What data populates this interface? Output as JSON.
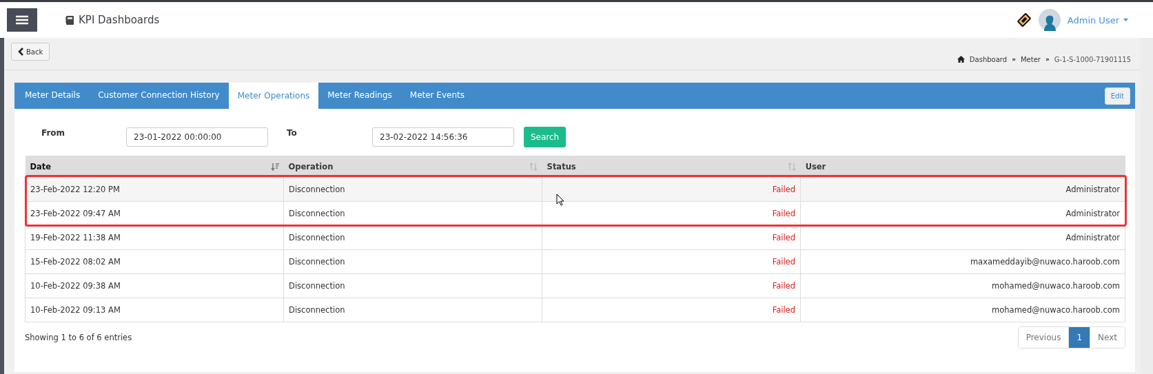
{
  "header": {
    "title": "KPI Dashboards",
    "user": "Admin User"
  },
  "back_button": "Back",
  "breadcrumb": [
    {
      "text": "Dashboard",
      "kind": "link"
    },
    {
      "text": "»",
      "kind": "separator"
    },
    {
      "text": "Meter",
      "kind": "link"
    },
    {
      "text": "»",
      "kind": "separator"
    },
    {
      "text": "G-1-S-1000-71901115",
      "kind": "current"
    }
  ],
  "tabs": [
    {
      "label": "Meter Details",
      "selected": false
    },
    {
      "label": "Customer Connection History",
      "selected": false
    },
    {
      "label": "Meter Operations",
      "selected": true
    },
    {
      "label": "Meter Readings",
      "selected": false
    },
    {
      "label": "Meter Events",
      "selected": false
    }
  ],
  "edit_button": "Edit",
  "filter": {
    "from_label": "From",
    "from_value": "23-01-2022 00:00:00",
    "to_label": "To",
    "to_value": "23-02-2022 14:56:36",
    "search_button": "Search"
  },
  "table": {
    "columns": [
      {
        "label": "Date",
        "sortable": true,
        "sorted": true
      },
      {
        "label": "Operation",
        "sortable": true,
        "sorted": false
      },
      {
        "label": "Status",
        "sortable": true,
        "sorted": false
      },
      {
        "label": "User",
        "sortable": false,
        "sorted": false
      }
    ],
    "rows": [
      {
        "date": "23-Feb-2022 12:20 PM",
        "operation": "Disconnection",
        "status": "Failed",
        "user": "Administrator",
        "hovered": true,
        "highlighted": true
      },
      {
        "date": "23-Feb-2022 09:47 AM",
        "operation": "Disconnection",
        "status": "Failed",
        "user": "Administrator",
        "hovered": false,
        "highlighted": true
      },
      {
        "date": "19-Feb-2022 11:38 AM",
        "operation": "Disconnection",
        "status": "Failed",
        "user": "Administrator",
        "hovered": false,
        "highlighted": false
      },
      {
        "date": "15-Feb-2022 08:02 AM",
        "operation": "Disconnection",
        "status": "Failed",
        "user": "maxameddayib@nuwaco.haroob.com",
        "hovered": false,
        "highlighted": false
      },
      {
        "date": "10-Feb-2022 09:38 AM",
        "operation": "Disconnection",
        "status": "Failed",
        "user": "mohamed@nuwaco.haroob.com",
        "hovered": false,
        "highlighted": false
      },
      {
        "date": "10-Feb-2022 09:13 AM",
        "operation": "Disconnection",
        "status": "Failed",
        "user": "mohamed@nuwaco.haroob.com",
        "hovered": false,
        "highlighted": false
      }
    ]
  },
  "footer": {
    "info": "Showing 1 to 6 of 6 entries",
    "pagination": [
      {
        "label": "Previous",
        "selected": false
      },
      {
        "label": "1",
        "selected": true
      },
      {
        "label": "Next",
        "selected": false
      }
    ]
  }
}
